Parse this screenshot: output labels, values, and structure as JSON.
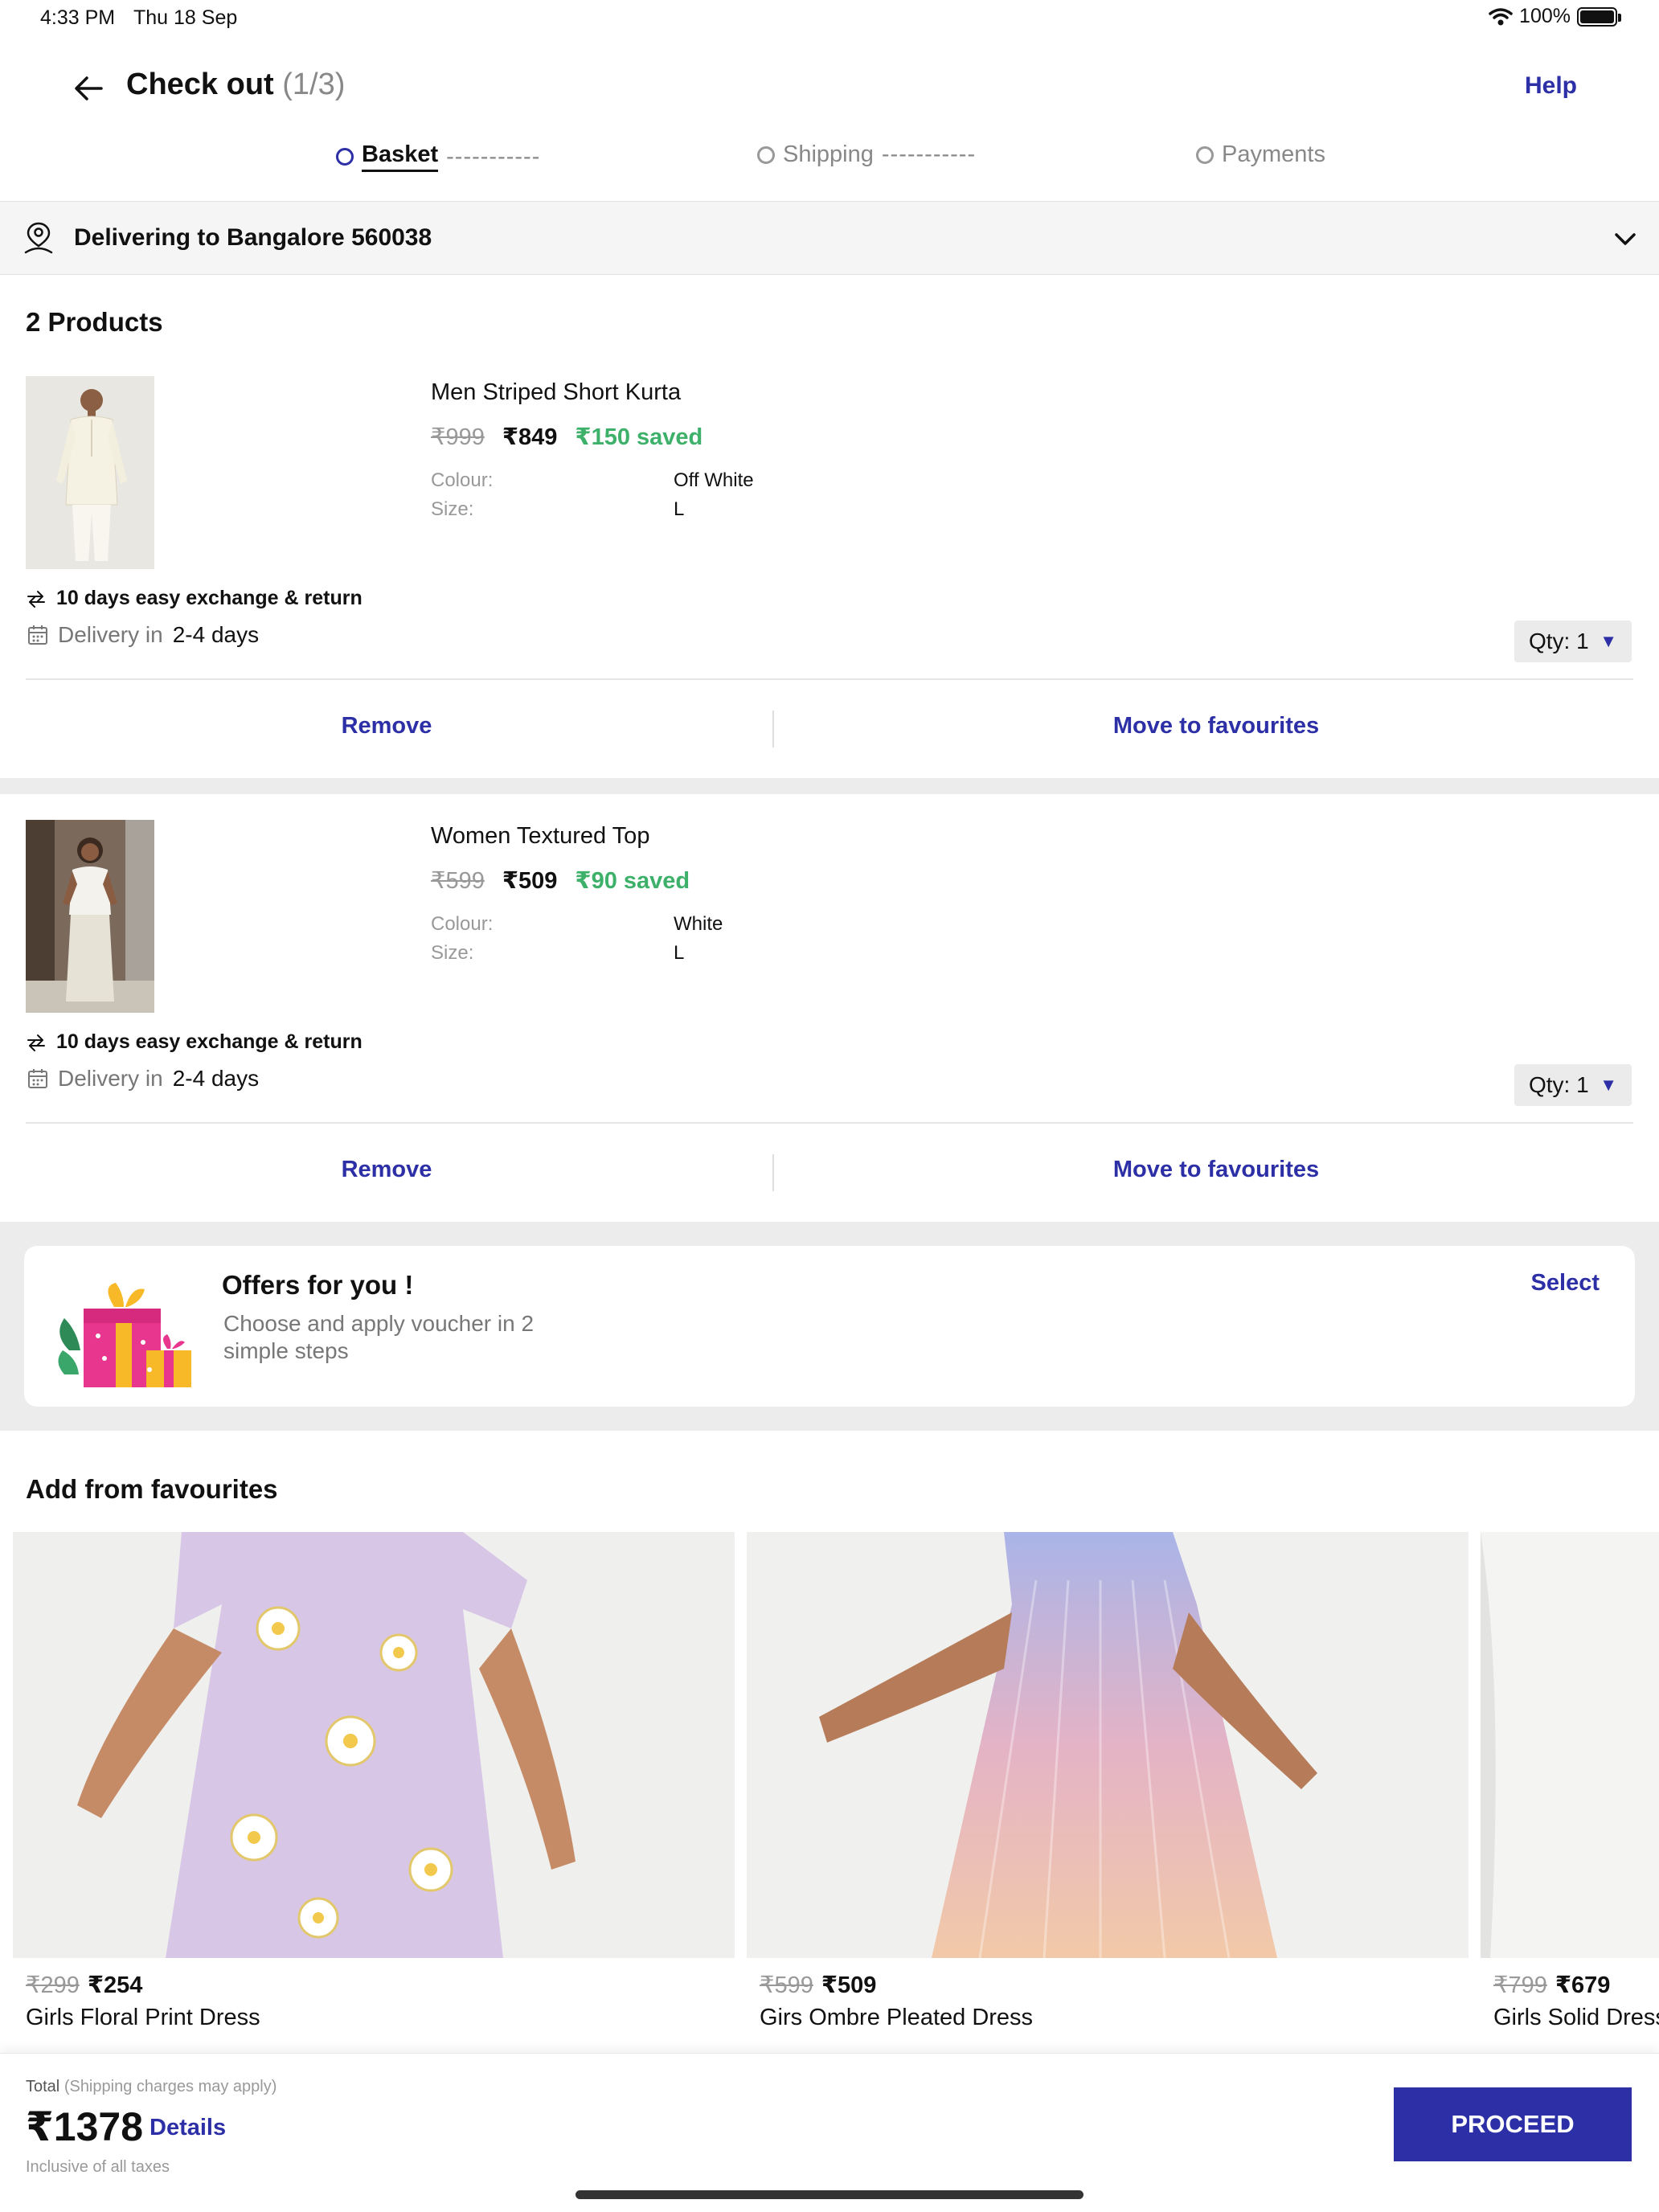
{
  "status_bar": {
    "time": "4:33 PM",
    "date": "Thu 18 Sep",
    "battery": "100%"
  },
  "header": {
    "title": "Check out",
    "step": "(1/3)",
    "help": "Help"
  },
  "stepper": [
    {
      "label": "Basket",
      "dashes": "-----------",
      "active": true
    },
    {
      "label": "Shipping",
      "dashes": "-----------",
      "active": false
    },
    {
      "label": "Payments",
      "dashes": "",
      "active": false
    }
  ],
  "delivery": {
    "text": "Delivering to Bangalore 560038"
  },
  "products_count": "2 Products",
  "labels": {
    "colour": "Colour:",
    "size": "Size:",
    "exchange": "10 days easy exchange & return",
    "delivery_prefix": "Delivery in",
    "remove": "Remove",
    "move_fav": "Move to favourites"
  },
  "products": [
    {
      "name": "Men Striped Short Kurta",
      "price_old": "₹999",
      "price_new": "₹849",
      "saved": "₹150 saved",
      "colour": "Off White",
      "size": "L",
      "delivery_days": "2-4 days",
      "qty": "Qty: 1"
    },
    {
      "name": "Women Textured Top",
      "price_old": "₹599",
      "price_new": "₹509",
      "saved": "₹90 saved",
      "colour": "White",
      "size": "L",
      "delivery_days": "2-4 days",
      "qty": "Qty: 1"
    }
  ],
  "offers": {
    "title": "Offers for you !",
    "subtitle": "Choose and apply voucher in 2 simple steps",
    "select": "Select"
  },
  "favourites": {
    "title": "Add from favourites",
    "items": [
      {
        "price_old": "₹299",
        "price_new": "₹254",
        "name": "Girls Floral Print Dress"
      },
      {
        "price_old": "₹599",
        "price_new": "₹509",
        "name": "Girs Ombre Pleated Dress"
      },
      {
        "price_old": "₹799",
        "price_new": "₹679",
        "name": "Girls Solid Dress"
      }
    ]
  },
  "footer": {
    "total_label": "Total",
    "total_note": "(Shipping charges may apply)",
    "total": "₹1378",
    "details": "Details",
    "inclusive": "Inclusive of all taxes",
    "proceed": "PROCEED"
  },
  "colors": {
    "accent": "#2c2fa6",
    "saved": "#3db06a",
    "section_bg": "#ececec"
  },
  "icons": [
    "back-arrow-icon",
    "wifi-icon",
    "battery-icon",
    "location-pin-icon",
    "chevron-down-icon",
    "exchange-arrows-icon",
    "calendar-icon",
    "dropdown-triangle-icon",
    "gift-boxes-icon"
  ]
}
